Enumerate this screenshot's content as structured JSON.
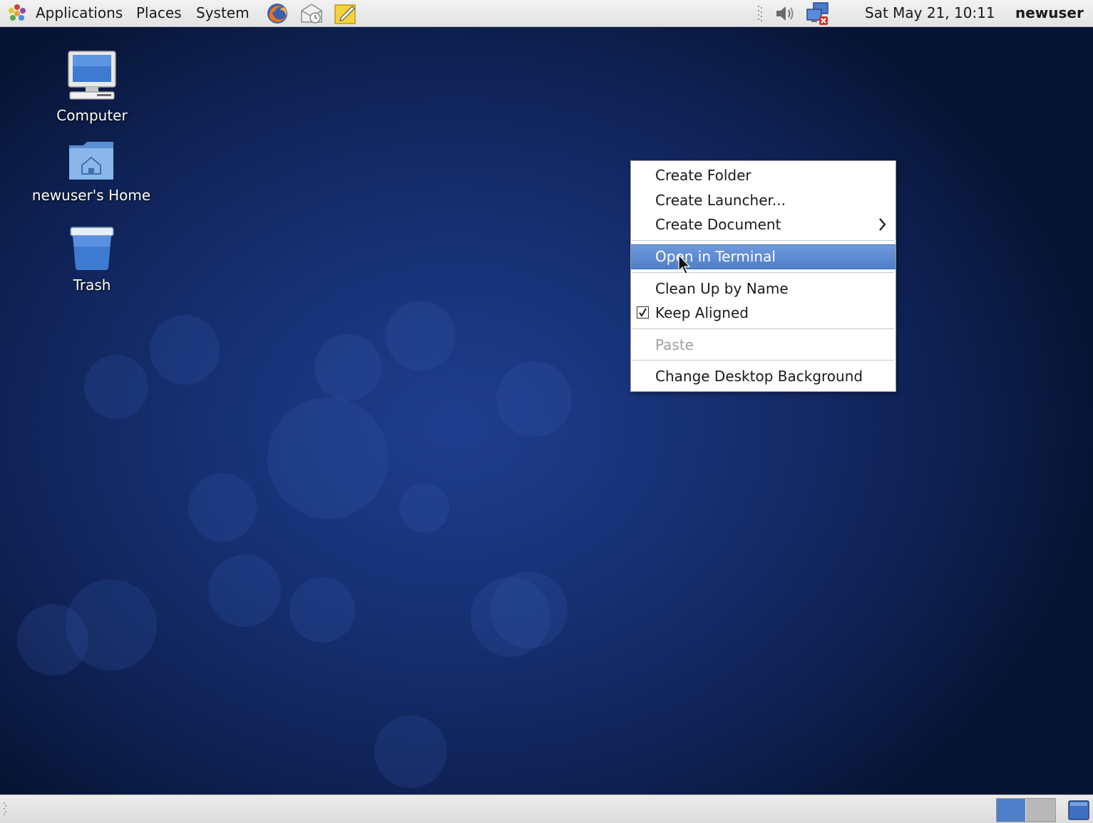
{
  "top_panel": {
    "menus": [
      "Applications",
      "Places",
      "System"
    ],
    "launchers": [
      "firefox-icon",
      "mail-icon",
      "notes-icon"
    ],
    "tray": [
      "volume-icon",
      "network-icon"
    ],
    "clock": "Sat May 21, 10:11",
    "user": "newuser"
  },
  "desktop": {
    "icons": [
      {
        "label": "Computer",
        "icon": "computer-icon"
      },
      {
        "label": "newuser's Home",
        "icon": "home-folder-icon"
      },
      {
        "label": "Trash",
        "icon": "trash-icon"
      }
    ]
  },
  "context_menu": {
    "create_folder": "Create Folder",
    "create_launcher": "Create Launcher...",
    "create_document": "Create Document",
    "open_in_terminal": "Open in Terminal",
    "clean_up_by_name": "Clean Up by Name",
    "keep_aligned": "Keep Aligned",
    "keep_aligned_checked": true,
    "paste": "Paste",
    "paste_enabled": false,
    "change_background": "Change Desktop Background",
    "highlighted_item": "Open in Terminal"
  },
  "bottom_panel": {
    "workspaces": 2,
    "active_workspace": 1
  },
  "colors": {
    "menu_highlight": "#5a88d0",
    "desktop_background": "#163072",
    "panel_background": "#e8e8e8"
  }
}
